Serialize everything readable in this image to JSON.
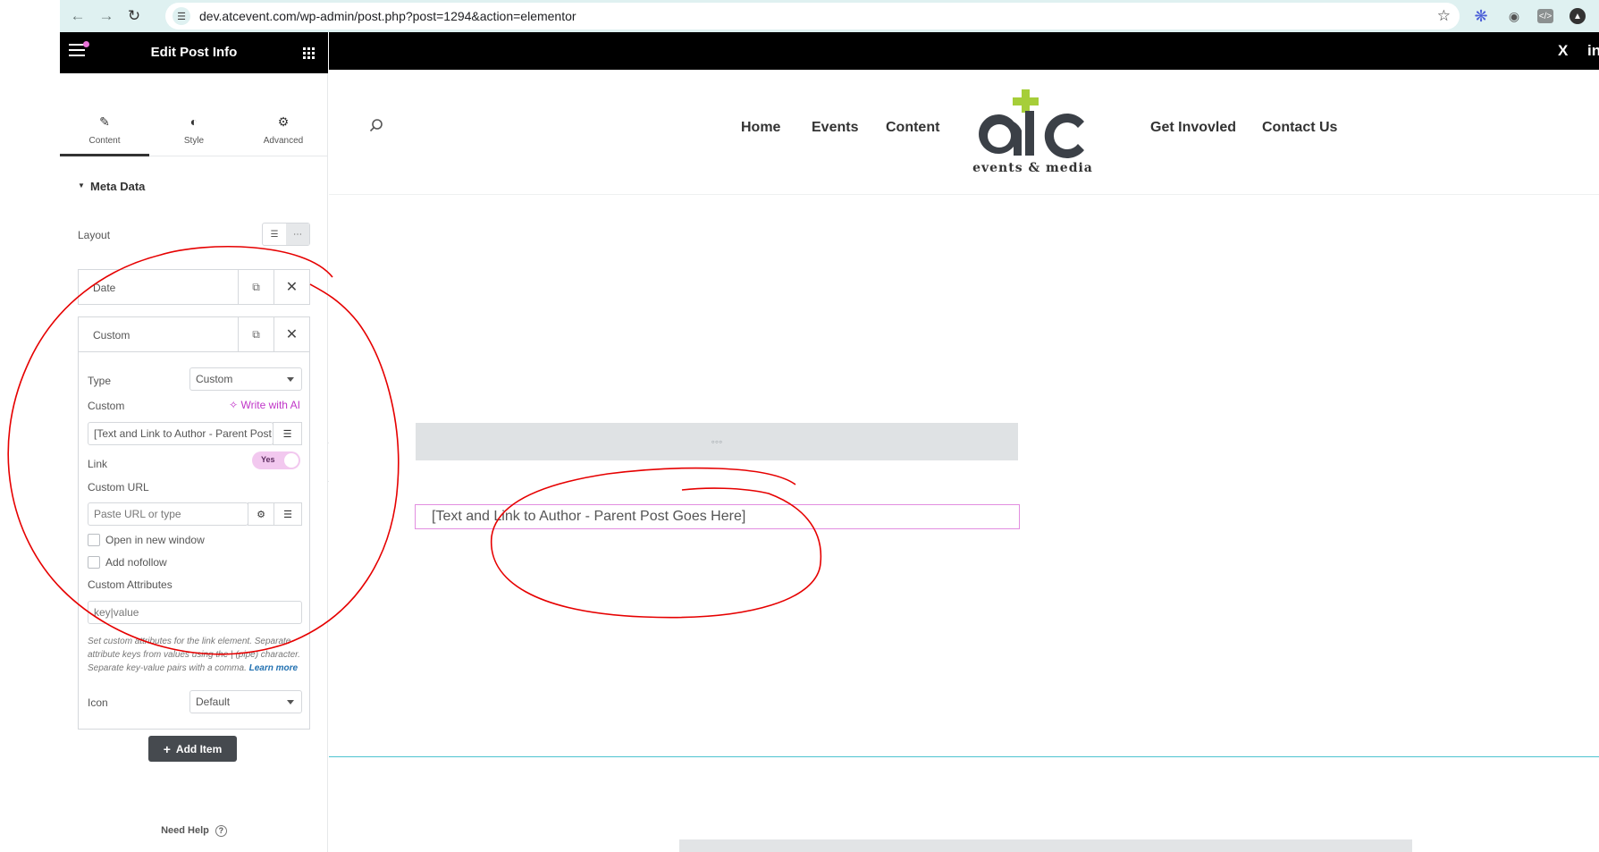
{
  "browser": {
    "url": "dev.atcevent.com/wp-admin/post.php?post=1294&action=elementor"
  },
  "editor": {
    "title": "Edit Post Info",
    "tabs": [
      {
        "label": "Content",
        "icon": "pencil-icon"
      },
      {
        "label": "Style",
        "icon": "half-circle-icon"
      },
      {
        "label": "Advanced",
        "icon": "gear-icon"
      }
    ],
    "section_title": "Meta Data",
    "layout_label": "Layout",
    "items": [
      {
        "label": "Date"
      },
      {
        "label": "Custom"
      }
    ],
    "custom": {
      "type_label": "Type",
      "type_value": "Custom",
      "custom_label": "Custom",
      "ai_label": "Write with AI",
      "custom_value": "[Text and Link to Author - Parent Post Goes Here]",
      "link_label": "Link",
      "link_toggle": "Yes",
      "custom_url_label": "Custom URL",
      "custom_url_placeholder": "Paste URL or type",
      "new_window_label": "Open in new window",
      "nofollow_label": "Add nofollow",
      "attributes_label": "Custom Attributes",
      "attributes_placeholder": "key|value",
      "attributes_help": "Set custom attributes for the link element. Separate attribute keys from values using the | (pipe) character. Separate key-value pairs with a comma.",
      "learn_more": "Learn more",
      "icon_label": "Icon",
      "icon_value": "Default"
    },
    "add_item_label": "Add Item",
    "need_help_label": "Need Help"
  },
  "site": {
    "nav_left": [
      "Home",
      "Events",
      "Content"
    ],
    "nav_right": [
      "Get Invovled",
      "Contact Us"
    ],
    "logo_text": "events & media",
    "social": [
      "X",
      "in"
    ],
    "author_text": "[Text and Link to Author - Parent Post Goes Here]",
    "placeholder_dots": "◦◦◦"
  },
  "colors": {
    "accent": "#c036c8",
    "logo_green": "#a6ce39",
    "logo_dark": "#3b4047",
    "annotation": "#e60000"
  }
}
